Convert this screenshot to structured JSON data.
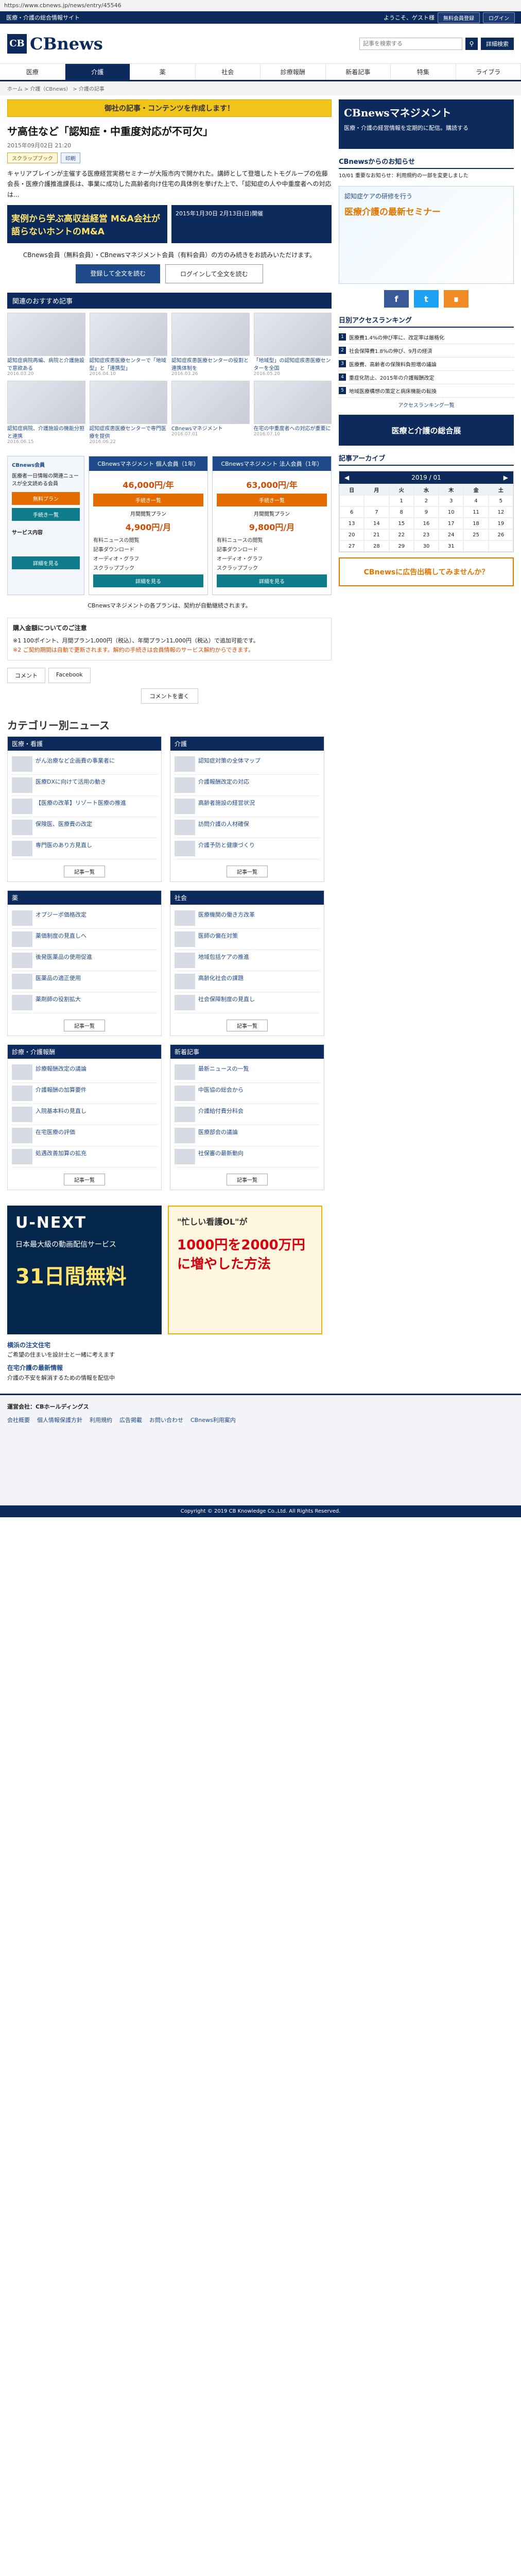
{
  "browser": {
    "url": "https://www.cbnews.jp/news/entry/45546"
  },
  "topbar": {
    "tagline": "医療・介護の総合情報サイト",
    "welcome": "ようこそ、ゲスト様",
    "register": "無料会員登録",
    "login": "ログイン"
  },
  "header": {
    "logo_mark": "CB",
    "logo_text": "CBnews",
    "search_placeholder": "記事を検索する",
    "detail_search": "詳細検索"
  },
  "nav": [
    "医療",
    "介護",
    "薬",
    "社会",
    "診療報酬",
    "新着記事",
    "特集",
    "ライブラ"
  ],
  "breadcrumb": "ホーム > 介護（CBnews） > 介護の記事",
  "article": {
    "banner": "御社の記事・コンテンツを作成します！",
    "title": "サ高住など「認知症・中重度対応が不可欠」",
    "meta": "2015年09月02日 21:20",
    "chips": [
      "スクラップブック",
      "印刷"
    ],
    "body": "キャリアブレインが主催する医療経営実務セミナーが大阪市内で開かれた。講師として登壇したトモグループの佐藤会長・医療介護推進課長は、事業に成功した高齢者向け住宅の具体例を挙げた上で、「認知症の人や中重度者への対応は...",
    "ads": [
      "実例から学ぶ高収益経営 M&A会社が語らないホントのM&A",
      "2015年1月30日 2月13日(日)開催"
    ],
    "subscribe_text": "CBnews会員（無料会員）・CBnewsマネジメント会員（有料会員）の方のみ続きをお読みいただけます。",
    "btn_register": "登録して全文を読む",
    "btn_login": "ログインして全文を読む"
  },
  "recommended": {
    "heading": "関連のおすすめ記事",
    "items": [
      {
        "title": "認知症病院再編、病院と介護施設で意欲ある",
        "date": "2016.03.20"
      },
      {
        "title": "認知症疾患医療センターで「地域型」と「連携型」",
        "date": "2016.04.10"
      },
      {
        "title": "認知症疾患医療センターの役割と連携体制を",
        "date": "2016.03.26"
      },
      {
        "title": "「地域型」の認知症疾患医療センターを全国",
        "date": "2016.05.20"
      },
      {
        "title": "認知症病院、介護施設の機能分担と連携",
        "date": "2016.06.15"
      },
      {
        "title": "認知症疾患医療センターで専門医療を提供",
        "date": "2016.06.22"
      },
      {
        "title": "CBnewsマネジメント",
        "date": "2016.07.01"
      },
      {
        "title": "在宅の中重度者への対応が重要に",
        "date": "2016.07.10"
      }
    ]
  },
  "plans": {
    "left_title": "CBnews会員",
    "left_desc": "医療者一日情報の関連ニュースが全文読める会員",
    "left_btn": "無料プラン",
    "left_btn2": "手続き一覧",
    "service_label": "サービス内容",
    "col1": {
      "header": "CBnewsマネジメント 個人会員（1年）",
      "price": "46,000円/年",
      "btn": "手続き一覧",
      "plan_label": "月間閲覧プラン",
      "price2": "4,900円/月",
      "features": [
        "有料ニュースの閲覧",
        "記事ダウンロード",
        "オーディオ・グラフ",
        "スクラップブック"
      ]
    },
    "col2": {
      "header": "CBnewsマネジメント 法人会員（1年）",
      "price": "63,000円/年",
      "btn": "手続き一覧",
      "plan_label": "月間閲覧プラン",
      "price2": "9,800円/月",
      "features": [
        "有料ニュースの閲覧",
        "記事ダウンロード",
        "オーディオ・グラフ",
        "スクラップブック"
      ]
    },
    "detail_btn": "詳細を見る"
  },
  "notice": {
    "summary": "CBnewsマネジメントの各プランは、契約が自動継続されます。",
    "title": "購入金額についてのご注意",
    "lines": [
      "※1 100ポイント、月間プラン1,000円（税込）、年間プラン11,000円（税込）で追加可能です。",
      "※2 ご契約期間は自動で更新されます。解約の手続きは会員情報のサービス解約からできます。"
    ]
  },
  "social_tabs": [
    "コメント",
    "Facebook",
    "コメントを書く"
  ],
  "sidebar": {
    "banner_title": "CBnewsマネジメント",
    "banner_sub": "医療・介護の経営情報を定期的に配信。購読する",
    "news_heading": "CBnewsからのお知らせ",
    "news": [
      "10/01 重要なお知らせ：利用規約の一部を変更しました"
    ],
    "ad_text": "認知症ケアの研修を行う",
    "ad_headline": "医療介護の最新セミナー",
    "ranking_heading": "日別アクセスランキング",
    "ranking": [
      "医療費1.4%の伸び率に、改定率は厳格化",
      "社会保障費1.8%の伸び、9月の経済",
      "医療費、高齢者の保険料負担増の議論",
      "重症化防止、2015年の介護報酬改定",
      "地域医療構想の策定と病床機能の転換"
    ],
    "more_ranking": "アクセスランキング一覧",
    "ad2": "医療と介護の総合展",
    "calendar_title": "記事アーカイブ",
    "calendar_month": "2019 / 01",
    "dow": [
      "日",
      "月",
      "火",
      "水",
      "木",
      "金",
      "土"
    ],
    "days": [
      "",
      "",
      "1",
      "2",
      "3",
      "4",
      "5",
      "6",
      "7",
      "8",
      "9",
      "10",
      "11",
      "12",
      "13",
      "14",
      "15",
      "16",
      "17",
      "18",
      "19",
      "20",
      "21",
      "22",
      "23",
      "24",
      "25",
      "26",
      "27",
      "28",
      "29",
      "30",
      "31",
      "",
      ""
    ],
    "ad3": "CBnewsに広告出稿してみませんか？"
  },
  "categories": {
    "title": "カテゴリー別ニュース",
    "blocks": [
      {
        "name": "医療・看護",
        "items": [
          "がん治療など企画費の事業者に",
          "医療DXに向けて活用の動き",
          "【医療の改革】リゾート医療の推進",
          "保険医、医療費の改定",
          "専門医のあり方見直し"
        ]
      },
      {
        "name": "介護",
        "items": [
          "認知症対策の全体マップ",
          "介護報酬改定の対応",
          "高齢者施設の経営状況",
          "訪問介護の人材確保",
          "介護予防と健康づくり"
        ]
      },
      {
        "name": "薬",
        "items": [
          "オプジーボ価格改定",
          "薬価制度の見直しへ",
          "後発医薬品の使用促進",
          "医薬品の適正使用",
          "薬剤師の役割拡大"
        ]
      },
      {
        "name": "社会",
        "items": [
          "医療機関の働き方改革",
          "医師の偏在対策",
          "地域包括ケアの推進",
          "高齢化社会の課題",
          "社会保障制度の見直し"
        ]
      },
      {
        "name": "診療・介護報酬",
        "items": [
          "診療報酬改定の議論",
          "介護報酬の加算要件",
          "入院基本料の見直し",
          "在宅医療の評価",
          "処遇改善加算の拡充"
        ]
      },
      {
        "name": "新着記事",
        "items": [
          "最新ニュースの一覧",
          "中医協の総会から",
          "介護給付費分科会",
          "医療部会の議論",
          "社保審の最新動向"
        ]
      }
    ],
    "more": "記事一覧"
  },
  "bottom_ads": {
    "unext_logo": "U-NEXT",
    "unext_text": "日本最大級の動画配信サービス",
    "unext_days": "31日間無料",
    "bonus_title": "\"忙しい看護OL\"が",
    "bonus_yen": "1000円を2000万円に増やした方法",
    "textads": [
      {
        "title": "横浜の注文住宅",
        "desc": "ご希望の住まいを設計士と一緒に考えます"
      },
      {
        "title": "在宅介護の最新情報",
        "desc": "介護の不安を解消するための情報を配信中"
      }
    ]
  },
  "footer": {
    "company": "運営会社：CBホールディングス",
    "links": [
      "会社概要",
      "個人情報保護方針",
      "利用規約",
      "広告掲載",
      "お問い合わせ",
      "CBnews利用案内"
    ],
    "copyright": "Copyright © 2019 CB Knowledge Co.,Ltd. All Rights Reserved."
  }
}
